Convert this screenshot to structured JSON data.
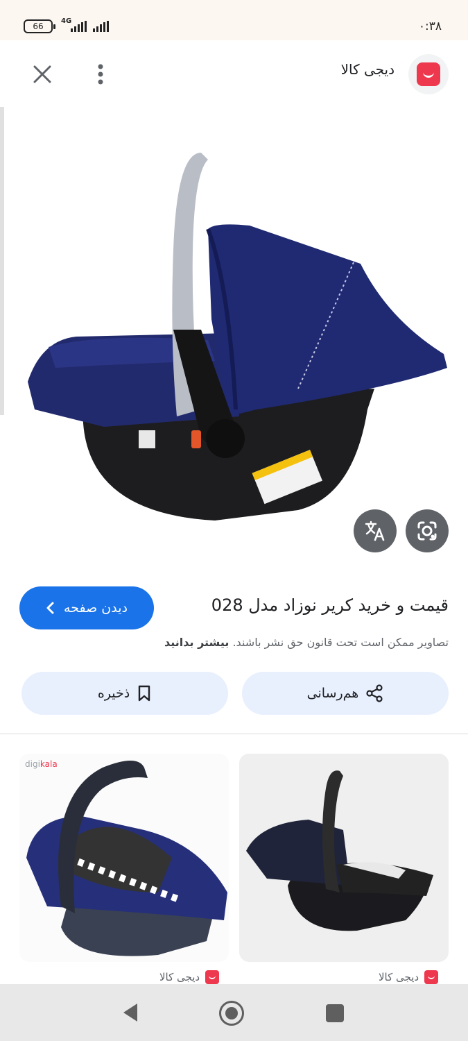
{
  "status_bar": {
    "battery": "66",
    "network": "4G",
    "time": "۰:۳۸"
  },
  "header": {
    "site_name": "دیجی کالا",
    "close_icon": "close-icon",
    "more_icon": "more-vert-icon"
  },
  "result": {
    "title": "قیمت و خرید کریر نوزاد مدل 028",
    "visit_label": "دیدن صفحه",
    "copyright_text": "تصاویر ممکن است تحت قانون حق نشر باشند.",
    "learn_more": "بیشتر بدانید",
    "share_label": "هم‌رسانی",
    "save_label": "ذخیره"
  },
  "related": [
    {
      "source": "دیجی کالا"
    },
    {
      "source": "دیجی کالا"
    }
  ],
  "colors": {
    "brand": "#ee384e",
    "accent": "#1a73e8",
    "chip": "#e8f0fe"
  }
}
